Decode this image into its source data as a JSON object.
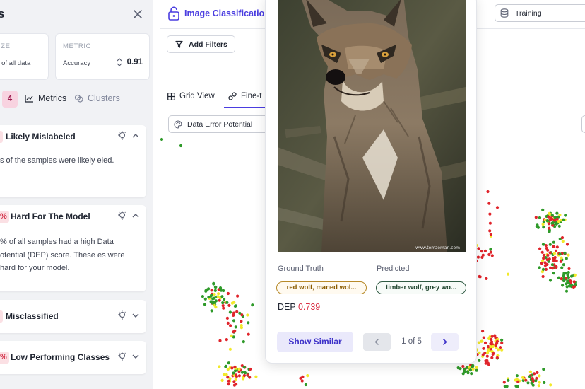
{
  "sidebar": {
    "title": "s",
    "stats": [
      {
        "caption": "SIZE",
        "sub": "% of all data"
      },
      {
        "caption": "METRIC",
        "sub": "Accuracy",
        "value": "0.91"
      }
    ],
    "tabs": {
      "count": "4",
      "metrics": "Metrics",
      "clusters": "Clusters"
    },
    "alerts": [
      {
        "tag": "",
        "title": "Likely Mislabeled",
        "body": "s of the samples were likely eled.",
        "expanded": true
      },
      {
        "tag": "%",
        "title": "Hard For The Model",
        "body": "% of all samples had a high Data otential (DEP) score. These es were hard for your model.",
        "expanded": true
      },
      {
        "tag": "",
        "title": "Misclassified",
        "body": "",
        "expanded": false
      },
      {
        "tag": "%",
        "title": "Low Performing Classes",
        "body": "",
        "expanded": false
      }
    ]
  },
  "header": {
    "project_title": "Image Classification",
    "split": "Training"
  },
  "toolbar": {
    "add_filters": "Add Filters"
  },
  "view_tabs": [
    {
      "label": "Grid View"
    },
    {
      "label": "Fine-t"
    }
  ],
  "color_by": {
    "value": "Data Error Potential"
  },
  "popup": {
    "ground_truth_label": "Ground Truth",
    "predicted_label": "Predicted",
    "ground_truth": "red wolf, maned wol...",
    "predicted": "timber wolf, grey wo...",
    "dep_label": "DEP",
    "dep_value": "0.739",
    "show_similar": "Show Similar",
    "page": "1 of 5",
    "watermark": "www.tomzeman.com"
  },
  "colors": {
    "accent": "#4a3de0",
    "dep_high": "#e0242b",
    "dep_mid": "#f2e92a",
    "dep_low": "#2f9a2a"
  },
  "icons": [
    "close-icon",
    "sort-icon",
    "metrics-icon",
    "clusters-icon",
    "bulb-icon",
    "chevron-up-icon",
    "chevron-down-icon",
    "lock-icon",
    "filter-icon",
    "database-icon",
    "grid-icon",
    "finetune-icon",
    "palette-icon",
    "chevron-left-icon",
    "chevron-right-icon"
  ]
}
